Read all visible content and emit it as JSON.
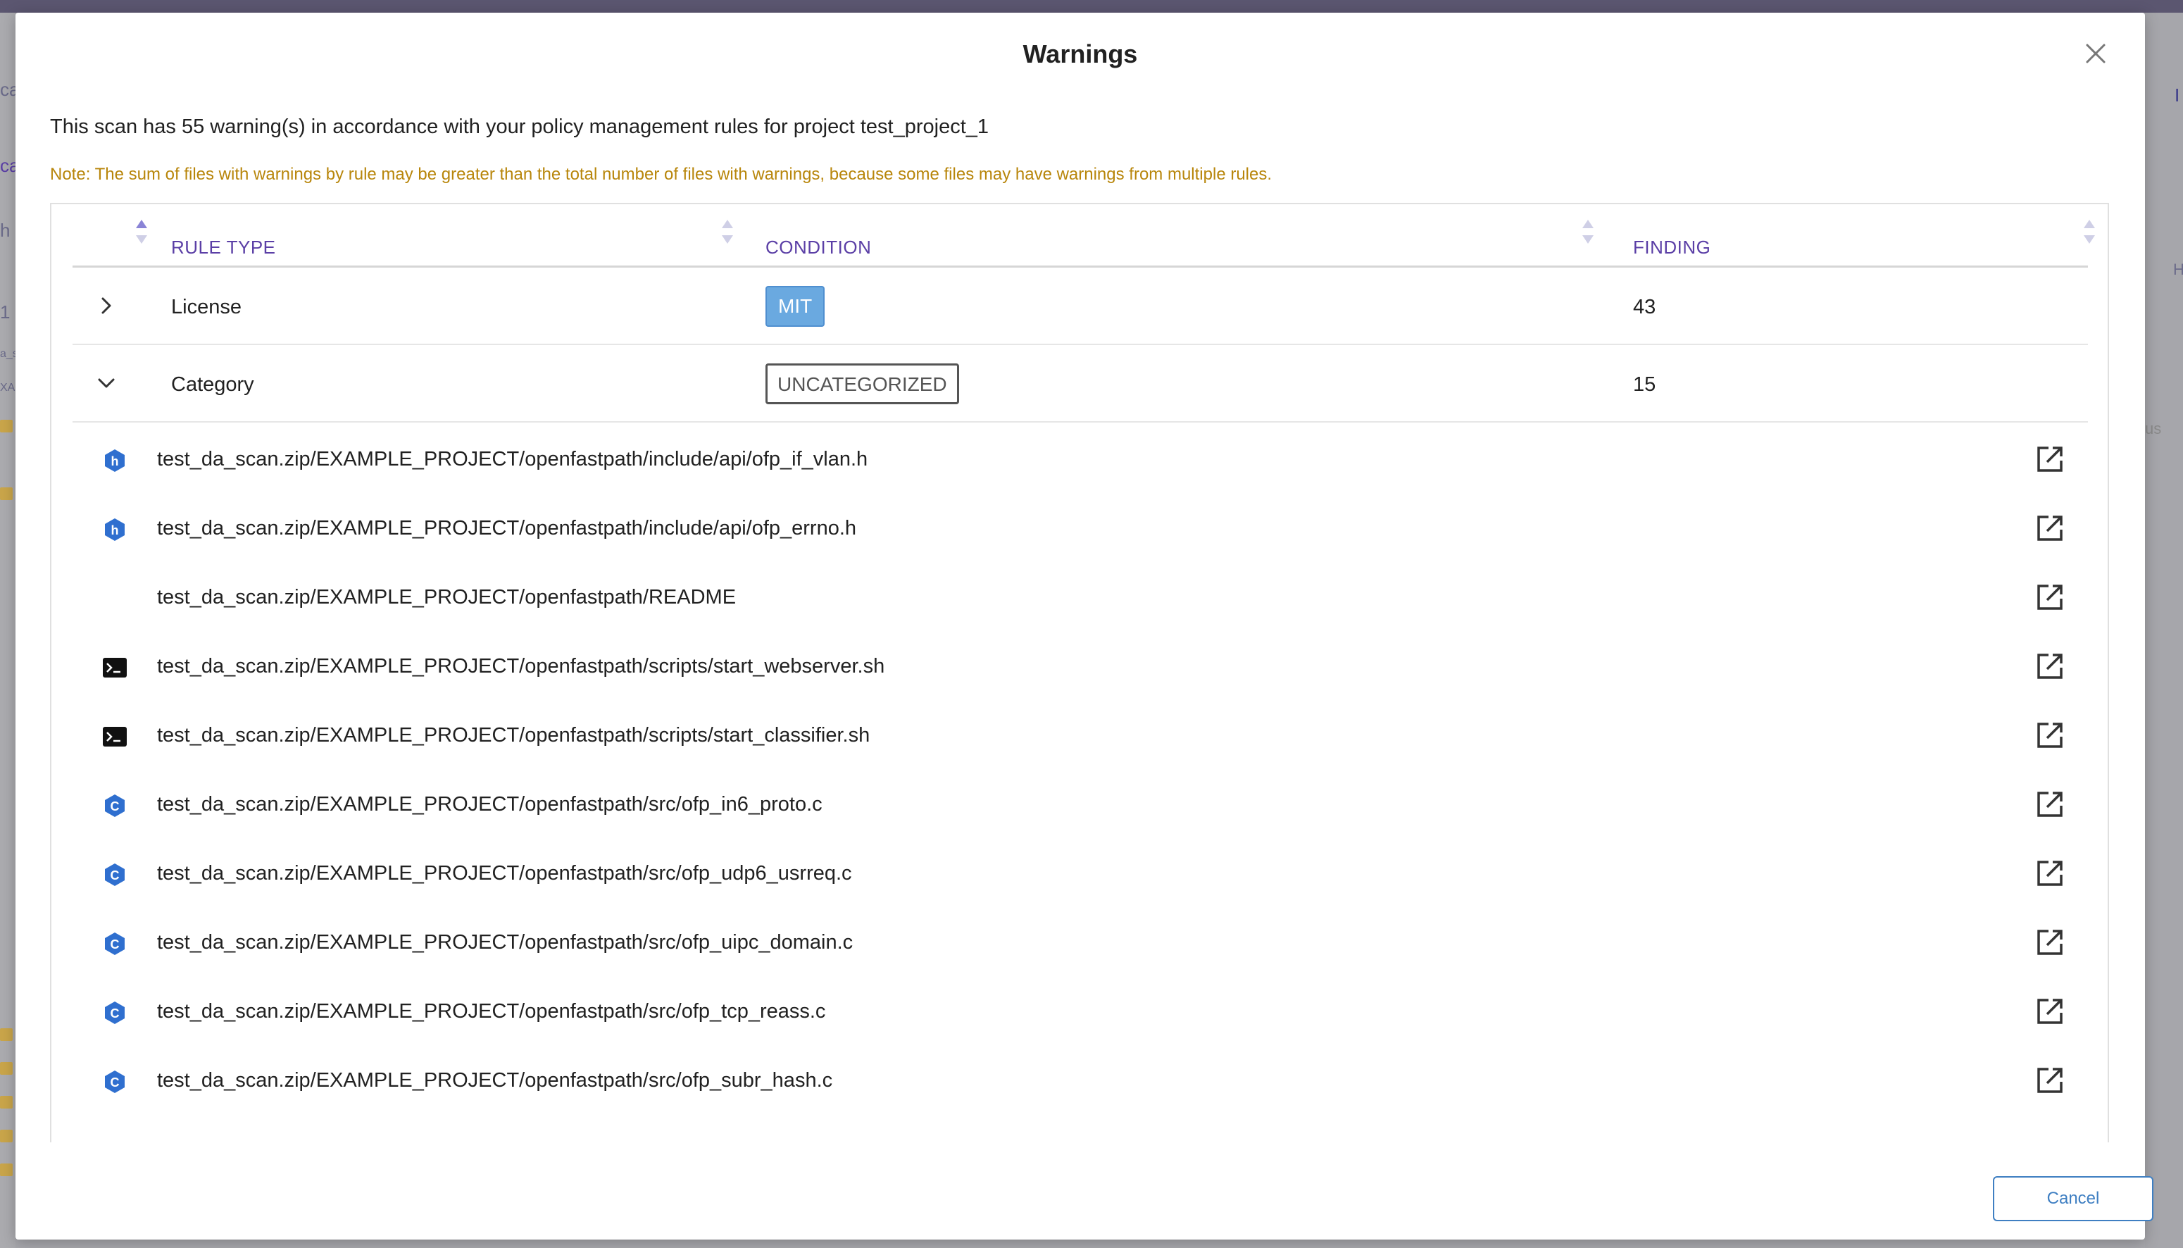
{
  "background": {
    "left_fragments": [
      "ca",
      "ca",
      "h",
      "1",
      "a_s",
      "XA"
    ],
    "right_fragments": [
      "I",
      "H",
      "us"
    ]
  },
  "modal": {
    "title": "Warnings",
    "summary": "This scan has 55 warning(s) in accordance with your policy management rules for project test_project_1",
    "note": "Note: The sum of files with warnings by rule may be greater than the total number of files with warnings, because some files may have warnings from multiple rules.",
    "cancel_label": "Cancel"
  },
  "table": {
    "columns": [
      "RULE TYPE",
      "CONDITION",
      "FINDING"
    ],
    "rows": [
      {
        "rule_type": "License",
        "condition": "MIT",
        "finding": "43",
        "expanded": false
      },
      {
        "rule_type": "Category",
        "condition": "UNCATEGORIZED",
        "finding": "15",
        "expanded": true
      }
    ]
  },
  "files": [
    {
      "path": "test_da_scan.zip/EXAMPLE_PROJECT/openfastpath/include/api/ofp_if_vlan.h",
      "icon": "header-file-icon"
    },
    {
      "path": "test_da_scan.zip/EXAMPLE_PROJECT/openfastpath/include/api/ofp_errno.h",
      "icon": "header-file-icon"
    },
    {
      "path": "test_da_scan.zip/EXAMPLE_PROJECT/openfastpath/README",
      "icon": "none"
    },
    {
      "path": "test_da_scan.zip/EXAMPLE_PROJECT/openfastpath/scripts/start_webserver.sh",
      "icon": "terminal-icon"
    },
    {
      "path": "test_da_scan.zip/EXAMPLE_PROJECT/openfastpath/scripts/start_classifier.sh",
      "icon": "terminal-icon"
    },
    {
      "path": "test_da_scan.zip/EXAMPLE_PROJECT/openfastpath/src/ofp_in6_proto.c",
      "icon": "c-file-icon"
    },
    {
      "path": "test_da_scan.zip/EXAMPLE_PROJECT/openfastpath/src/ofp_udp6_usrreq.c",
      "icon": "c-file-icon"
    },
    {
      "path": "test_da_scan.zip/EXAMPLE_PROJECT/openfastpath/src/ofp_uipc_domain.c",
      "icon": "c-file-icon"
    },
    {
      "path": "test_da_scan.zip/EXAMPLE_PROJECT/openfastpath/src/ofp_tcp_reass.c",
      "icon": "c-file-icon"
    },
    {
      "path": "test_da_scan.zip/EXAMPLE_PROJECT/openfastpath/src/ofp_subr_hash.c",
      "icon": "c-file-icon"
    }
  ],
  "colors": {
    "accent": "#5b3fa6",
    "note": "#b8860b",
    "mit_tag": "#6aa9e0",
    "button": "#3f7fc2"
  }
}
